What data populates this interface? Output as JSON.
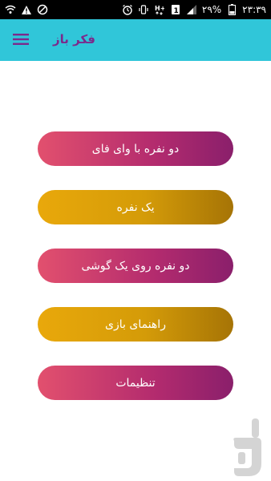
{
  "status_bar": {
    "battery_percent": "۲۹%",
    "time": "۲۳:۳۹"
  },
  "app_bar": {
    "title": "فکر باز"
  },
  "menu": {
    "items": [
      {
        "label": "دو نفره با وای فای",
        "style": "pink"
      },
      {
        "label": "یک نفره",
        "style": "gold"
      },
      {
        "label": "دو نفره روی یک گوشی",
        "style": "pink"
      },
      {
        "label": "راهنمای بازی",
        "style": "gold"
      },
      {
        "label": "تنظیمات",
        "style": "pink"
      }
    ]
  },
  "colors": {
    "app_bar": "#30C6D9",
    "title": "#7B2A8C",
    "pink_start": "#E2506E",
    "pink_end": "#8A1F6B",
    "gold_start": "#E9A80B",
    "gold_end": "#A67406"
  },
  "icons": {
    "menu": "hamburger-icon",
    "wifi": "wifi-icon",
    "alert": "warning-icon",
    "blocked": "no-signal-icon",
    "alarm": "alarm-icon",
    "vibrate": "vibrate-icon",
    "hplus": "h-plus-icon",
    "sim": "sim-icon",
    "signal": "signal-icon",
    "battery": "battery-icon",
    "logo": "cafebazaar-logo"
  }
}
